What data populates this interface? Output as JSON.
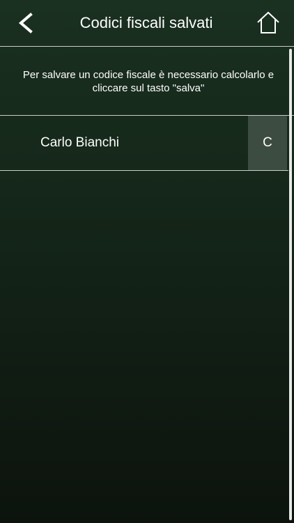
{
  "header": {
    "title": "Codici fiscali salvati",
    "back_icon": "chevron-left-icon",
    "home_icon": "home-icon"
  },
  "info": {
    "text": "Per salvare un codice fiscale è necessario calcolarlo e cliccare sul tasto \"salva\""
  },
  "saved_list": [
    {
      "name": "Carlo Bianchi",
      "action_label": "C"
    }
  ],
  "colors": {
    "background_top": "#1a3020",
    "background_bottom": "#0c130d",
    "row_action_bg": "#3d4c41",
    "divider": "#c9cfca",
    "text": "#ffffff"
  }
}
